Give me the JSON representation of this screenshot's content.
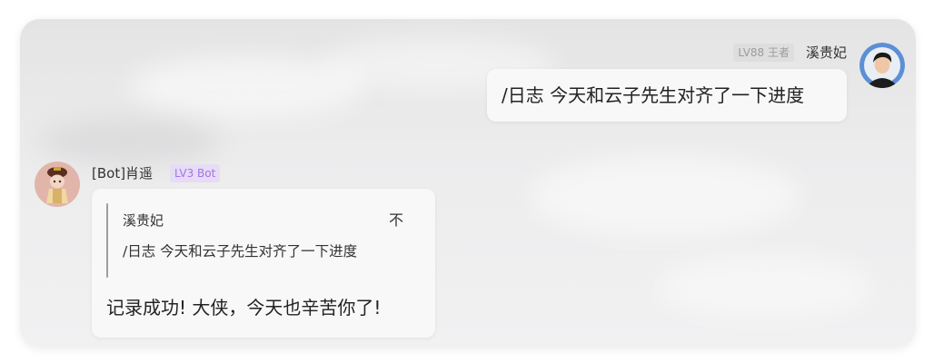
{
  "colors": {
    "card_background": "#ececed",
    "bubble_background": "#f8f8f9",
    "bot_badge_bg": "#e6dcf6",
    "bot_badge_text": "#a673e6",
    "user_badge_bg": "#dedede",
    "user_badge_text": "#9b9b9b",
    "quote_bar": "#9e9e9e"
  },
  "user_message": {
    "level_badge": "LV88 王者",
    "nickname": "溪贵妃",
    "avatar_icon": "user-avatar-icon",
    "text": "/日志 今天和云子先生对齐了一下进度"
  },
  "bot_message": {
    "nickname": "[Bot]肖遥",
    "level_badge": "LV3 Bot",
    "avatar_icon": "bot-avatar-icon",
    "quote": {
      "author": "溪贵妃",
      "more_glyph": "不",
      "text": "/日志 今天和云子先生对齐了一下进度"
    },
    "reply_text": "记录成功! 大侠，今天也辛苦你了!"
  }
}
